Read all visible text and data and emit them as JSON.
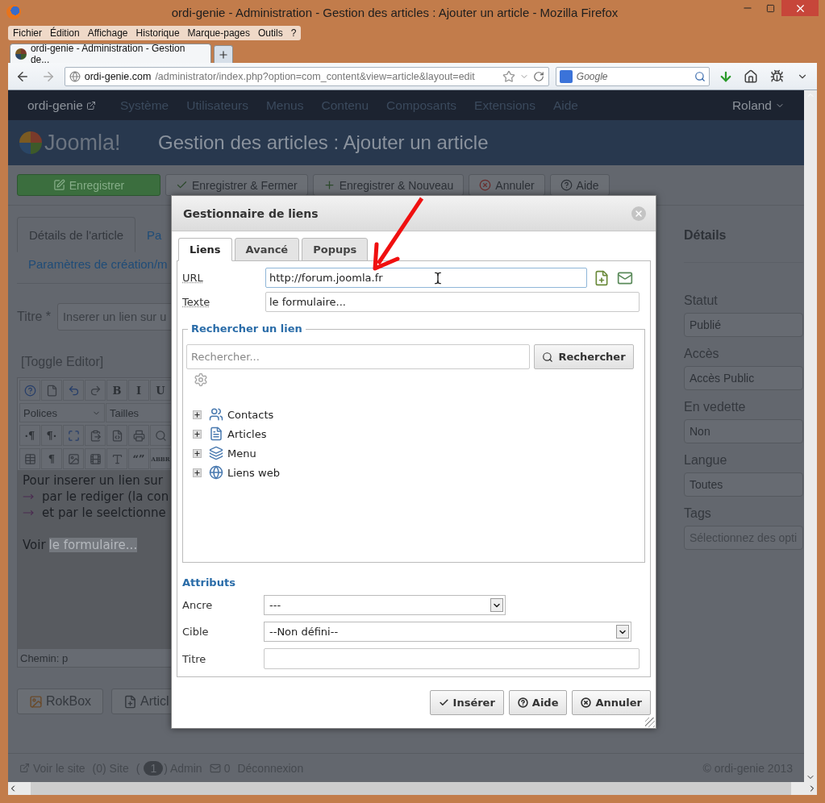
{
  "window": {
    "title": "ordi-genie - Administration - Gestion des articles : Ajouter un article - Mozilla Firefox"
  },
  "menu_bar": [
    "Fichier",
    "Édition",
    "Affichage",
    "Historique",
    "Marque-pages",
    "Outils",
    "?"
  ],
  "tabs": [
    {
      "label": "ordi-genie - Administration - Gestion de...",
      "selected": true
    }
  ],
  "address_bar": {
    "host": "ordi-genie.com",
    "path": "/administrator/index.php?option=com_content&view=article&layout=edit"
  },
  "search_bar": {
    "placeholder": "Google"
  },
  "admin_nav": {
    "site": "ordi-genie",
    "items": [
      "Système",
      "Utilisateurs",
      "Menus",
      "Contenu",
      "Composants",
      "Extensions",
      "Aide"
    ],
    "user": "Roland"
  },
  "header": {
    "logo": "Joomla!",
    "title": "Gestion des articles : Ajouter un article"
  },
  "toolbar": [
    {
      "label": "Enregistrer",
      "kind": "save"
    },
    {
      "label": "Enregistrer & Fermer",
      "kind": "check"
    },
    {
      "label": "Enregistrer & Nouveau",
      "kind": "plus"
    },
    {
      "label": "Annuler",
      "kind": "cancel"
    },
    {
      "label": "Aide",
      "kind": "help"
    }
  ],
  "article_tabs": [
    {
      "label": "Détails de l'article",
      "selected": true
    },
    {
      "label": "Pa",
      "selected": false
    },
    {
      "label": "Paramètres de création/m",
      "selected": false
    }
  ],
  "title_field": {
    "label": "Titre *",
    "value": "Inserer un lien sur u"
  },
  "toggle_editor": "[Toggle Editor]",
  "editor": {
    "toolbar_rows": [
      [
        {
          "kind": "help"
        },
        {
          "kind": "page"
        },
        {
          "kind": "undo"
        },
        {
          "kind": "redo"
        },
        {
          "kind": "glyph",
          "label": "B"
        },
        {
          "kind": "glyph",
          "label": "I"
        },
        {
          "kind": "glyph",
          "label": "U"
        }
      ],
      [
        {
          "kind": "select",
          "label": "Polices"
        },
        {
          "kind": "select",
          "label": "Tailles"
        }
      ],
      [
        {
          "kind": "glyph",
          "label": "·¶"
        },
        {
          "kind": "glyph",
          "label": "¶·"
        },
        {
          "kind": "fullscreen"
        },
        {
          "kind": "paste"
        },
        {
          "kind": "code"
        },
        {
          "kind": "print"
        },
        {
          "kind": "find"
        }
      ],
      [
        {
          "kind": "table"
        },
        {
          "kind": "glyph",
          "label": "¶"
        },
        {
          "kind": "image"
        },
        {
          "kind": "media"
        },
        {
          "kind": "style"
        },
        {
          "kind": "glyph",
          "label": "“”"
        },
        {
          "kind": "glyph",
          "label": "ABBR"
        }
      ]
    ],
    "paragraphs": [
      {
        "kind": "text",
        "text": "Pour inserer un lien sur"
      },
      {
        "kind": "bullet",
        "text": "par le rediger (la con"
      },
      {
        "kind": "bullet",
        "text": "et par le seelctionne"
      },
      {
        "kind": "link",
        "text": "Voir",
        "selection": "le formulaire..."
      }
    ],
    "path": "Chemin: p"
  },
  "editor_buttons": [
    {
      "label": "RokBox",
      "kind": "image"
    },
    {
      "label": "Articl",
      "kind": "doc"
    }
  ],
  "details": {
    "title": "Détails",
    "fields": [
      {
        "label": "Statut",
        "kind": "select",
        "value": "Publié"
      },
      {
        "label": "Accès",
        "kind": "select",
        "value": "Accès Public"
      },
      {
        "label": "En vedette",
        "kind": "select",
        "value": "Non"
      },
      {
        "label": "Langue",
        "kind": "select",
        "value": "Toutes"
      },
      {
        "label": "Tags",
        "kind": "tags",
        "placeholder": "Sélectionnez des opti"
      }
    ]
  },
  "footer": {
    "items": [
      {
        "kind": "link",
        "label": "Voir le site"
      },
      {
        "kind": "text",
        "label": "(0) Site"
      },
      {
        "kind": "text",
        "label": "("
      },
      {
        "kind": "badge",
        "label": "1"
      },
      {
        "kind": "text",
        "label": ") Admin"
      },
      {
        "kind": "mail",
        "label": "0"
      },
      {
        "kind": "text",
        "label": "Déconnexion"
      }
    ],
    "copyright": "© ordi-genie 2013"
  },
  "dialog": {
    "title": "Gestionnaire de liens",
    "tabs": [
      {
        "label": "Liens",
        "selected": true
      },
      {
        "label": "Avancé",
        "selected": false
      },
      {
        "label": "Popups",
        "selected": false
      }
    ],
    "url": {
      "label": "URL",
      "value": "http://forum.joomla.fr"
    },
    "text": {
      "label": "Texte",
      "value": "le formulaire..."
    },
    "search": {
      "legend": "Rechercher un lien",
      "placeholder": "Rechercher...",
      "button": "Rechercher"
    },
    "tree": [
      {
        "label": "Contacts",
        "kind": "contacts",
        "expanded": false
      },
      {
        "label": "Articles",
        "kind": "articles",
        "expanded": false
      },
      {
        "label": "Menu",
        "kind": "menu",
        "expanded": false
      },
      {
        "label": "Liens web",
        "kind": "weblinks",
        "expanded": false
      }
    ],
    "attributes": {
      "legend": "Attributs",
      "fields": [
        {
          "label": "Ancre",
          "kind": "short-select",
          "value": "---"
        },
        {
          "label": "Cible",
          "kind": "select",
          "value": "--Non défini--"
        },
        {
          "label": "Titre",
          "kind": "input"
        }
      ]
    },
    "buttons": [
      {
        "label": "Insérer",
        "kind": "check"
      },
      {
        "label": "Aide",
        "kind": "help"
      },
      {
        "label": "Annuler",
        "kind": "cancel"
      }
    ]
  }
}
